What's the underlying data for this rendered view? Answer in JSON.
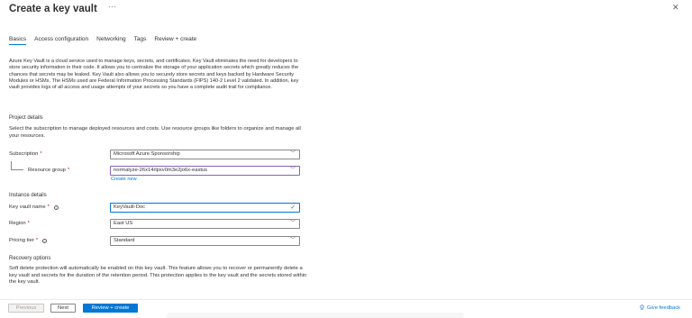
{
  "header": {
    "title": "Create a key vault",
    "more": "···",
    "close": "✕"
  },
  "tabs": [
    {
      "label": "Basics",
      "active": true
    },
    {
      "label": "Access configuration",
      "active": false
    },
    {
      "label": "Networking",
      "active": false
    },
    {
      "label": "Tags",
      "active": false
    },
    {
      "label": "Review + create",
      "active": false
    }
  ],
  "description": "Azure Key Vault is a cloud service used to manage keys, secrets, and certificates. Key Vault eliminates the need for developers to store security information in their code. It allows you to centralize the storage of your application secrets which greatly reduces the chances that secrets may be leaked. Key Vault also allows you to securely store secrets and keys backed by Hardware Security Modules or HSMs. The HSMs used are Federal Information Processing Standards (FIPS) 140-2 Level 2 validated. In addition, key vault provides logs of all access and usage attempts of your secrets so you have a complete audit trail for compliance.",
  "project_details": {
    "heading": "Project details",
    "text": "Select the subscription to manage deployed resources and costs. Use resource groups like folders to organize and manage all your resources.",
    "subscription_label": "Subscription",
    "subscription_value": "Microsoft Azure Sponsorship",
    "resource_group_label": "Resource group",
    "resource_group_value": "normalyze-26x14rlpxv0m3e2jo6x-eastus",
    "create_new": "Create new"
  },
  "instance_details": {
    "heading": "Instance details",
    "name_label": "Key vault name",
    "name_value": "KeyVault-Doc",
    "region_label": "Region",
    "region_value": "East US",
    "tier_label": "Pricing tier",
    "tier_value": "Standard"
  },
  "recovery": {
    "heading": "Recovery options",
    "text": "Soft delete protection will automatically be enabled on this key vault. This feature allows you to recover or permanently delete a key vault and secrets for the duration of the retention period. This protection applies to the key vault and the secrets stored within the key vault."
  },
  "footer": {
    "previous": "Previous",
    "next": "Next",
    "review": "Review + create",
    "feedback": "Give feedback"
  },
  "required_marker": "*",
  "colors": {
    "accent": "#0078d4",
    "required": "#a4262c",
    "valid": "#107c10"
  }
}
